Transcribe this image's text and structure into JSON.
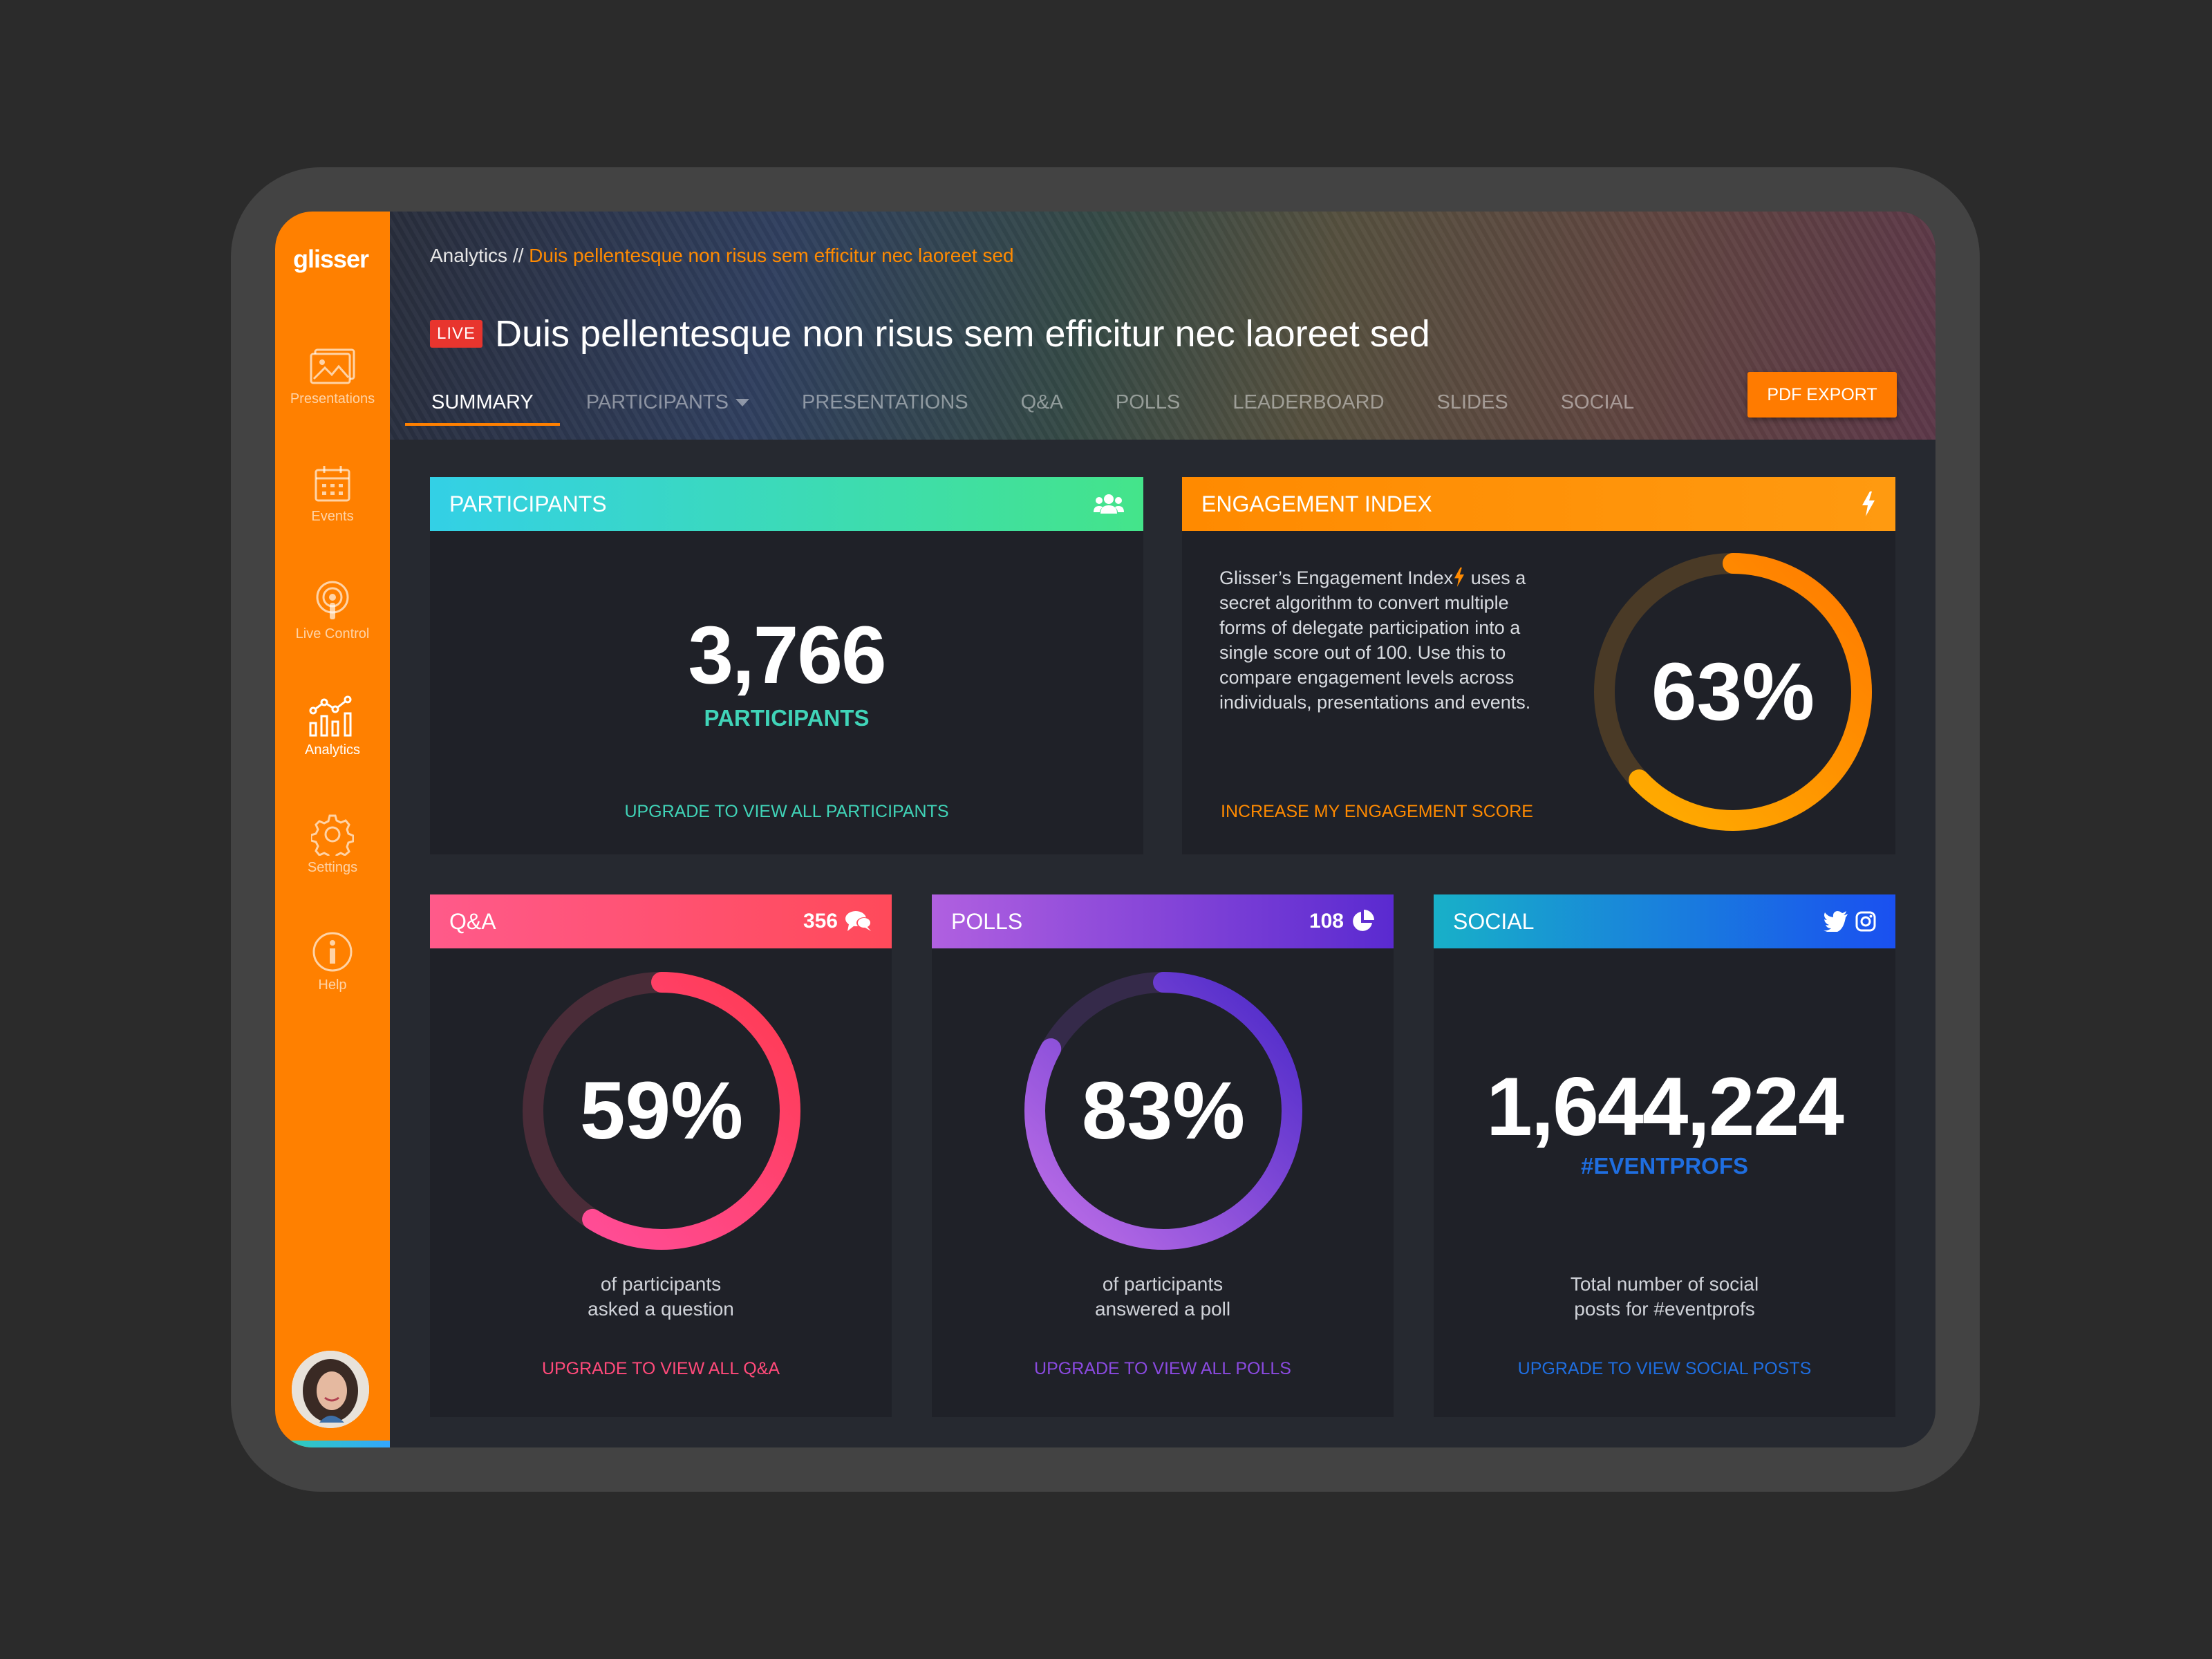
{
  "app": {
    "logo": "glisser"
  },
  "sidebar": {
    "items": [
      {
        "label": "Presentations",
        "icon": "image-icon"
      },
      {
        "label": "Events",
        "icon": "calendar-icon"
      },
      {
        "label": "Live Control",
        "icon": "podcast-icon"
      },
      {
        "label": "Analytics",
        "icon": "analytics-icon",
        "active": true
      },
      {
        "label": "Settings",
        "icon": "gear-icon"
      },
      {
        "label": "Help",
        "icon": "info-icon"
      }
    ]
  },
  "header": {
    "breadcrumb_root": "Analytics //",
    "breadcrumb_current": "Duis pellentesque non risus sem efficitur nec laoreet sed",
    "live_label": "LIVE",
    "title": "Duis pellentesque non risus sem efficitur nec laoreet sed",
    "tabs": [
      "SUMMARY",
      "PARTICIPANTS",
      "PRESENTATIONS",
      "Q&A",
      "POLLS",
      "LEADERBOARD",
      "SLIDES",
      "SOCIAL"
    ],
    "active_tab": "SUMMARY",
    "pdf_export": "PDF EXPORT"
  },
  "participants": {
    "title": "PARTICIPANTS",
    "value": "3,766",
    "label": "PARTICIPANTS",
    "upgrade": "UPGRADE TO VIEW ALL PARTICIPANTS",
    "color": "#40d4b8"
  },
  "engagement": {
    "title": "ENGAGEMENT INDEX",
    "desc_before": "Glisser’s Engagement Index",
    "desc_after": " uses a secret algorithm to convert multiple forms of delegate participation into a single score out of 100. Use this to compare engagement levels across individuals, presentations and events.",
    "value": "63%",
    "fraction": 0.63,
    "cta": "INCREASE MY ENGAGEMENT SCORE",
    "color": "#ff8a00"
  },
  "qa": {
    "title": "Q&A",
    "count": "356",
    "value": "59%",
    "fraction": 0.59,
    "desc_line1": "of participants",
    "desc_line2": "asked a question",
    "upgrade": "UPGRADE TO VIEW ALL Q&A",
    "color": "#ff4a7a"
  },
  "polls": {
    "title": "POLLS",
    "count": "108",
    "value": "83%",
    "fraction": 0.83,
    "desc_line1": "of participants",
    "desc_line2": "answered a poll",
    "upgrade": "UPGRADE TO VIEW ALL POLLS",
    "color": "#8a4ae0"
  },
  "social": {
    "title": "SOCIAL",
    "value": "1,644,224",
    "hashtag": "#EVENTPROFS",
    "desc_line1": "Total number of social",
    "desc_line2": "posts for #eventprofs",
    "upgrade": "UPGRADE TO VIEW SOCIAL POSTS",
    "color": "#1f6ee0"
  }
}
